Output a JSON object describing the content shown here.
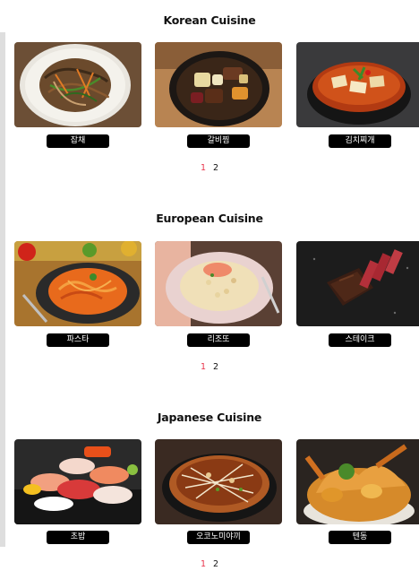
{
  "sections": [
    {
      "title": "Korean Cuisine",
      "items": [
        {
          "label": "잡채",
          "icon": "japchae-photo"
        },
        {
          "label": "갈비찜",
          "icon": "galbijjim-photo"
        },
        {
          "label": "김치찌개",
          "icon": "kimchi-jjigae-photo"
        }
      ],
      "pages": [
        "1",
        "2"
      ],
      "active_page": "1"
    },
    {
      "title": "European Cuisine",
      "items": [
        {
          "label": "파스타",
          "icon": "pasta-photo"
        },
        {
          "label": "리조또",
          "icon": "risotto-photo"
        },
        {
          "label": "스테이크",
          "icon": "steak-photo"
        }
      ],
      "pages": [
        "1",
        "2"
      ],
      "active_page": "1"
    },
    {
      "title": "Japanese Cuisine",
      "items": [
        {
          "label": "초밥",
          "icon": "sushi-photo"
        },
        {
          "label": "오코노미야끼",
          "icon": "okonomiyaki-photo"
        },
        {
          "label": "텐동",
          "icon": "tendon-photo"
        }
      ],
      "pages": [
        "1",
        "2"
      ],
      "active_page": "1"
    }
  ],
  "colors": {
    "active_page": "#e8334a",
    "label_bg": "#000000",
    "label_text": "#ffffff"
  }
}
